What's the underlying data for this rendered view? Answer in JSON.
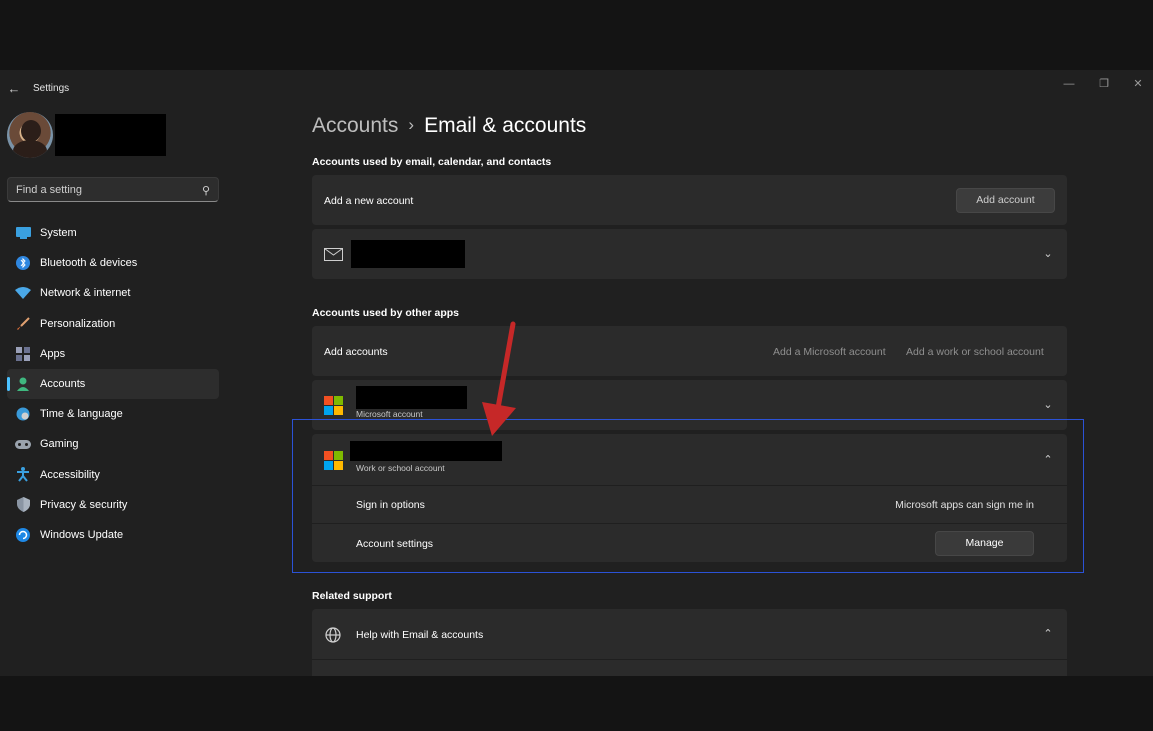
{
  "window": {
    "app_title": "Settings",
    "back_icon": "back-arrow-icon",
    "controls": [
      "minimize-icon",
      "restore-icon",
      "close-icon"
    ]
  },
  "sidebar": {
    "search_placeholder": "Find a setting",
    "items": [
      {
        "label": "System",
        "icon": "system-icon",
        "active": false
      },
      {
        "label": "Bluetooth & devices",
        "icon": "bluetooth-icon",
        "active": false
      },
      {
        "label": "Network & internet",
        "icon": "wifi-icon",
        "active": false
      },
      {
        "label": "Personalization",
        "icon": "brush-icon",
        "active": false
      },
      {
        "label": "Apps",
        "icon": "apps-icon",
        "active": false
      },
      {
        "label": "Accounts",
        "icon": "person-icon",
        "active": true
      },
      {
        "label": "Time & language",
        "icon": "clock-globe-icon",
        "active": false
      },
      {
        "label": "Gaming",
        "icon": "gamepad-icon",
        "active": false
      },
      {
        "label": "Accessibility",
        "icon": "accessibility-icon",
        "active": false
      },
      {
        "label": "Privacy & security",
        "icon": "shield-icon",
        "active": false
      },
      {
        "label": "Windows Update",
        "icon": "update-icon",
        "active": false
      }
    ]
  },
  "header": {
    "parent": "Accounts",
    "separator": "›",
    "current": "Email & accounts"
  },
  "email_section": {
    "title": "Accounts used by email, calendar, and contacts",
    "add_new_label": "Add a new account",
    "add_button": "Add account"
  },
  "other_apps_section": {
    "title": "Accounts used by other apps",
    "add_label": "Add accounts",
    "add_microsoft": "Add a Microsoft account",
    "add_work": "Add a work or school account",
    "microsoft_account_sub": "Microsoft account",
    "work_account_sub": "Work or school account",
    "sign_in_options_label": "Sign in options",
    "sign_in_options_value": "Microsoft apps can sign me in",
    "account_settings_label": "Account settings",
    "manage_button": "Manage"
  },
  "related_support": {
    "title": "Related support",
    "help_label": "Help with Email & accounts"
  },
  "colors": {
    "accent": "#4cc2ff",
    "annotation_arrow": "#c62828",
    "annotation_box": "#2b52d6"
  }
}
